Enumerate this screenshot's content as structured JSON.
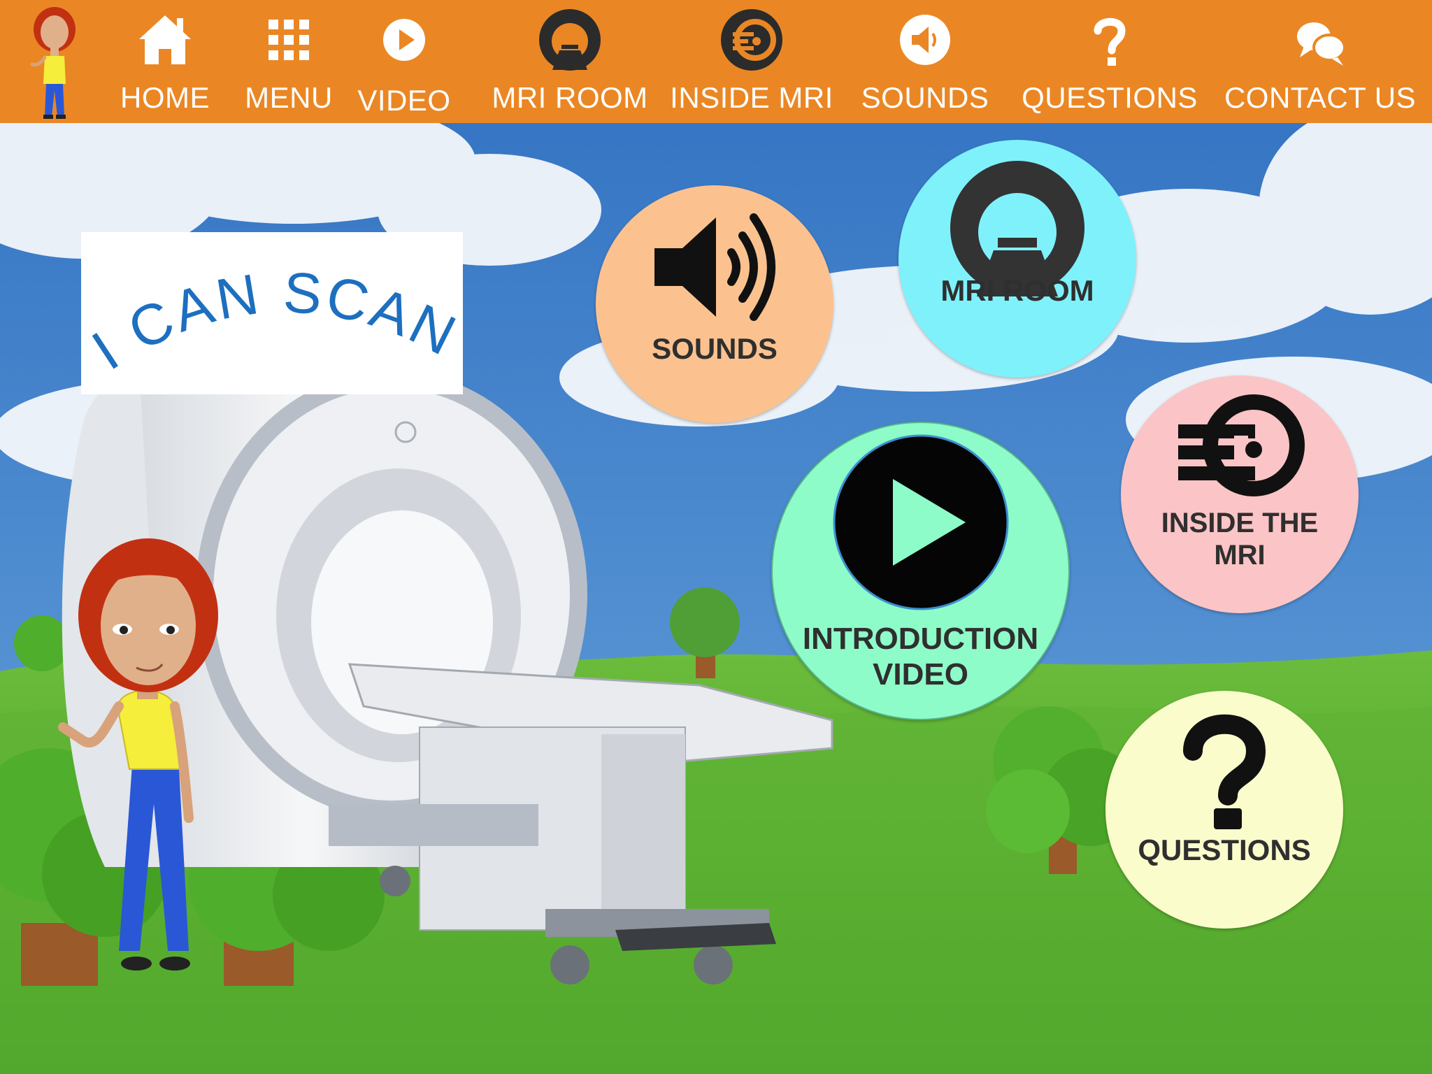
{
  "nav": {
    "items": [
      {
        "label": "HOME",
        "icon": "home-icon"
      },
      {
        "label": "MENU",
        "icon": "grid-icon"
      },
      {
        "label": "VIDEO",
        "icon": "play-icon"
      },
      {
        "label": "MRI ROOM",
        "icon": "mri-scanner-icon"
      },
      {
        "label": "INSIDE MRI",
        "icon": "inside-mri-icon"
      },
      {
        "label": "SOUNDS",
        "icon": "speaker-icon"
      },
      {
        "label": "QUESTIONS",
        "icon": "question-icon"
      },
      {
        "label": "CONTACT US",
        "icon": "chat-bubbles-icon"
      }
    ]
  },
  "logo": {
    "text": "I CAN SCAN"
  },
  "buttons": {
    "sounds": "SOUNDS",
    "mri_room": "MRI ROOM",
    "intro_video_line1": "INTRODUCTION",
    "intro_video_line2": "VIDEO",
    "inside_mri_line1": "INSIDE THE",
    "inside_mri_line2": "MRI",
    "questions": "QUESTIONS"
  },
  "colors": {
    "topbar": "#ea8724",
    "sounds": "#fbc28f",
    "mri_room": "#7ff1fb",
    "intro_video": "#8dfcc9",
    "inside_mri": "#fbc4c6",
    "questions": "#fbfccb",
    "logo_text": "#1d6fbf"
  }
}
